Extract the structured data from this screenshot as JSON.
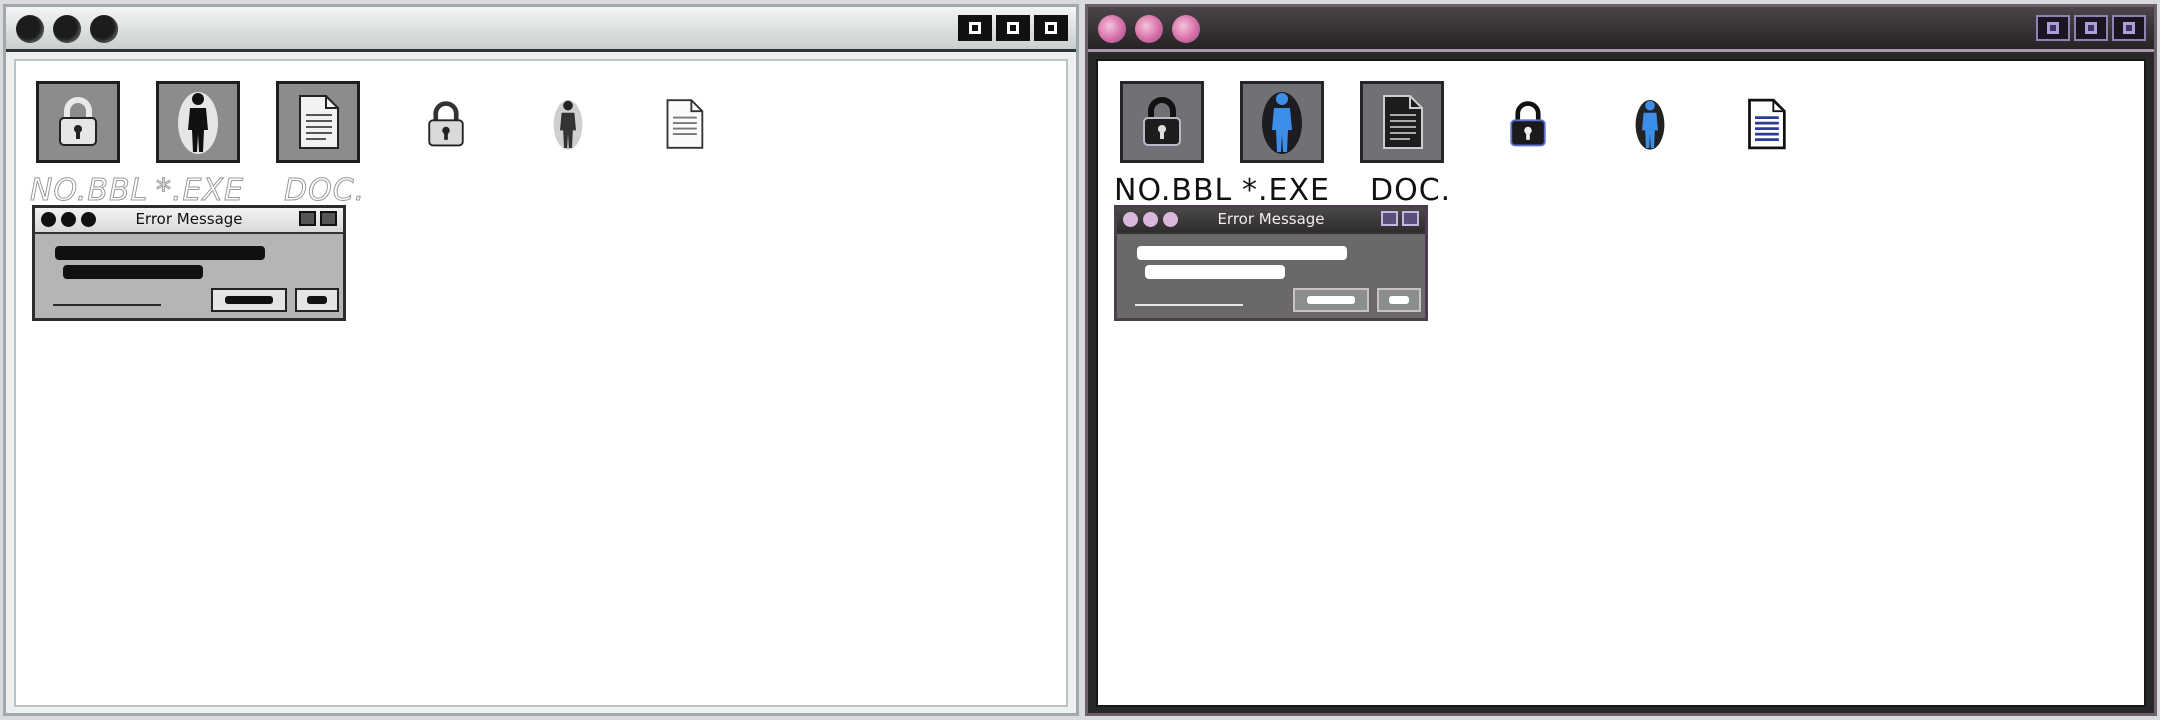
{
  "windows": [
    {
      "theme": "light",
      "desktop_icons": [
        {
          "icon": "lock-icon",
          "label": "NO.BBL"
        },
        {
          "icon": "person-icon",
          "label": "*.EXE"
        },
        {
          "icon": "document-icon",
          "label": "DOC."
        }
      ],
      "dialog": {
        "title": "Error Message"
      }
    },
    {
      "theme": "dark",
      "desktop_icons": [
        {
          "icon": "lock-icon",
          "label": "NO.BBL"
        },
        {
          "icon": "person-icon",
          "label": "*.EXE"
        },
        {
          "icon": "document-icon",
          "label": "DOC."
        }
      ],
      "dialog": {
        "title": "Error Message"
      }
    }
  ],
  "colors": {
    "dark_accent": "#d66fa6",
    "figure_blue": "#3d8ee8"
  }
}
